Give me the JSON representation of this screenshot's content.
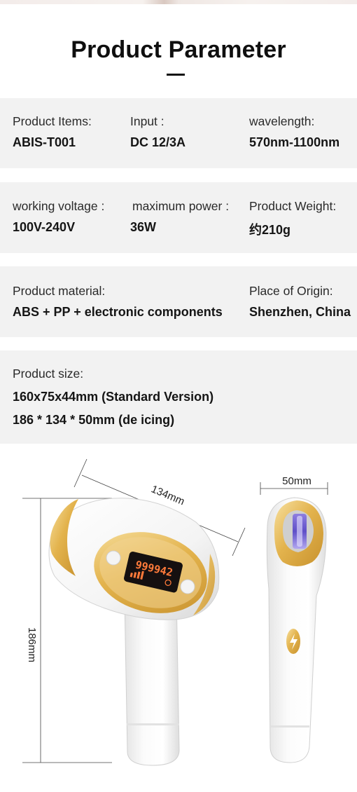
{
  "header": {
    "title": "Product Parameter"
  },
  "rows": [
    {
      "cells": [
        {
          "label": "Product Items:",
          "value": "ABIS-T001"
        },
        {
          "label": "Input :",
          "value": "DC 12/3A"
        },
        {
          "label": "wavelength:",
          "value": "570nm-1100nm"
        }
      ]
    },
    {
      "cells": [
        {
          "label": "working voltage :",
          "value": "100V-240V"
        },
        {
          "label": "maximum power :",
          "value": "36W"
        },
        {
          "label": "Product Weight:",
          "value": "约210g"
        }
      ]
    },
    {
      "cells": [
        {
          "label": "Product material:",
          "value": "ABS + PP + electronic components"
        },
        {
          "label": "Place of Origin:",
          "value": "Shenzhen, China"
        }
      ]
    },
    {
      "cells": [
        {
          "label": "Product size:",
          "values": [
            "160x75x44mm (Standard Version)",
            "186 * 134 * 50mm (de icing)"
          ]
        }
      ]
    }
  ],
  "figure": {
    "dim_width": "134mm",
    "dim_height": "186mm",
    "dim_depth": "50mm",
    "display_reading": "999942"
  }
}
